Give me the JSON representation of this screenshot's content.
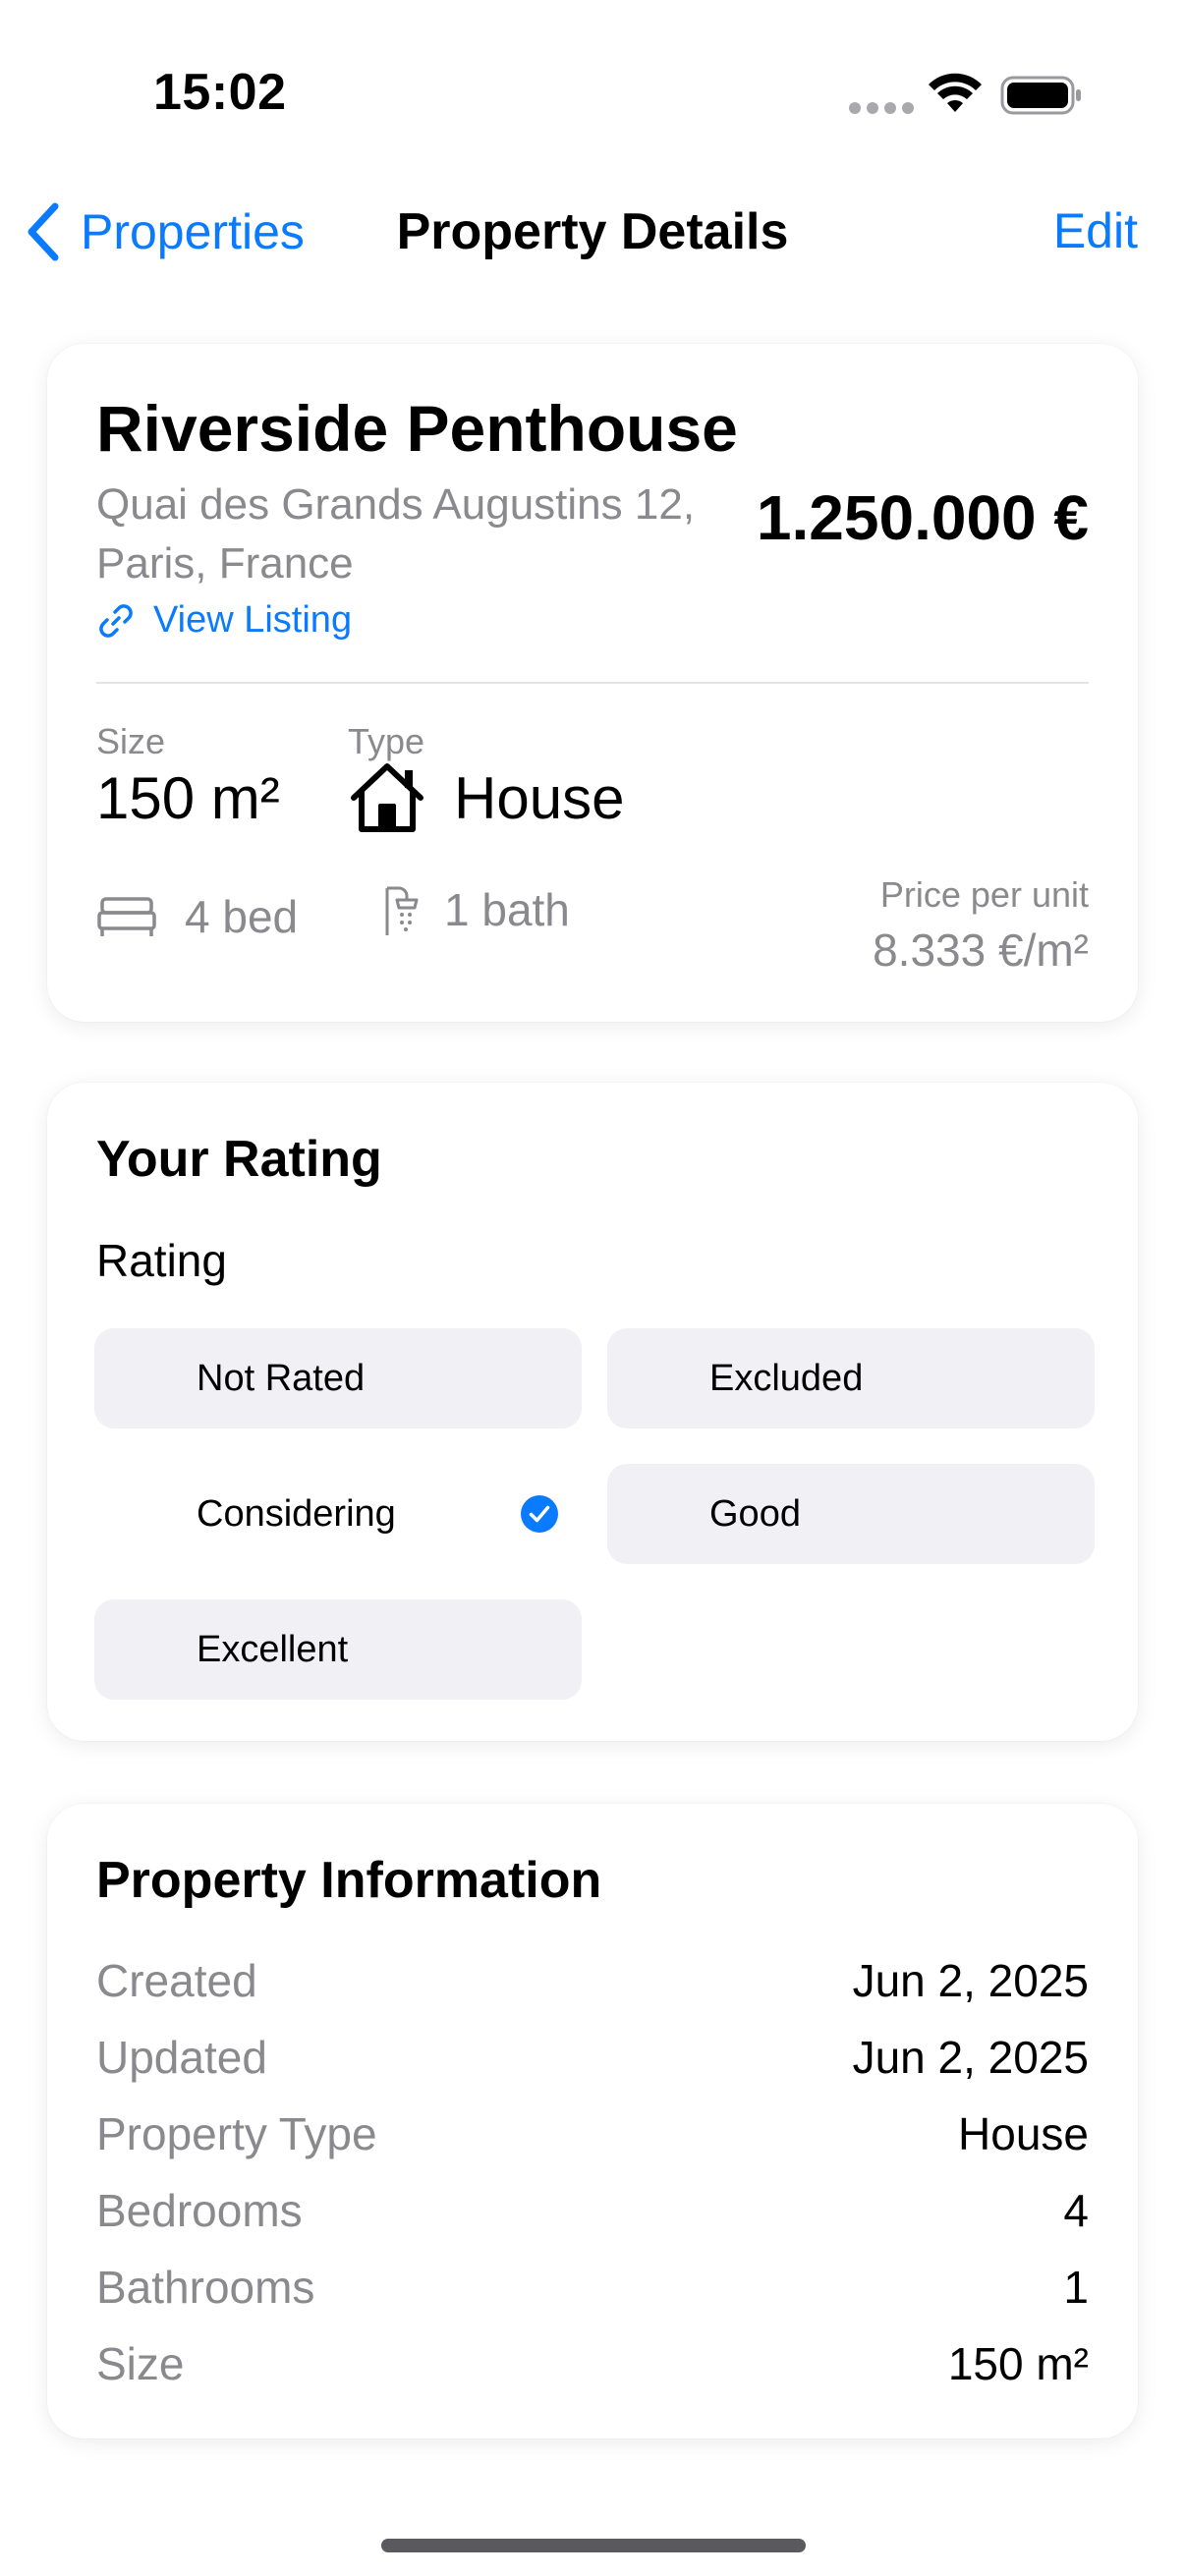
{
  "status_bar": {
    "time": "15:02"
  },
  "nav": {
    "back_label": "Properties",
    "title": "Property Details",
    "edit_label": "Edit"
  },
  "property": {
    "title": "Riverside Penthouse",
    "address": "Quai des Grands Augustins 12, Paris, France",
    "price": "1.250.000 €",
    "view_listing": "View Listing",
    "size_label": "Size",
    "size_value": "150 m²",
    "type_label": "Type",
    "type_value": "House",
    "beds": "4 bed",
    "baths": "1 bath",
    "ppu_label": "Price per unit",
    "ppu_value": "8.333 €/m²"
  },
  "rating": {
    "title": "Your Rating",
    "label": "Rating",
    "options": [
      {
        "label": "Not Rated",
        "selected": false
      },
      {
        "label": "Excluded",
        "selected": false
      },
      {
        "label": "Considering",
        "selected": true
      },
      {
        "label": "Good",
        "selected": false
      },
      {
        "label": "Excellent",
        "selected": false
      }
    ]
  },
  "info": {
    "title": "Property Information",
    "rows": [
      {
        "key": "Created",
        "value": "Jun 2, 2025"
      },
      {
        "key": "Updated",
        "value": "Jun 2, 2025"
      },
      {
        "key": "Property Type",
        "value": "House"
      },
      {
        "key": "Bedrooms",
        "value": "4"
      },
      {
        "key": "Bathrooms",
        "value": "1"
      },
      {
        "key": "Size",
        "value": "150 m²"
      }
    ]
  },
  "colors": {
    "accent": "#0a7aff",
    "secondary_text": "#8a8a8e",
    "chip_bg": "#f0f0f5"
  },
  "icons": [
    "chevron-left-icon",
    "link-icon",
    "house-icon",
    "bed-icon",
    "shower-icon",
    "checkmark-circle-icon",
    "wifi-icon",
    "battery-icon"
  ]
}
